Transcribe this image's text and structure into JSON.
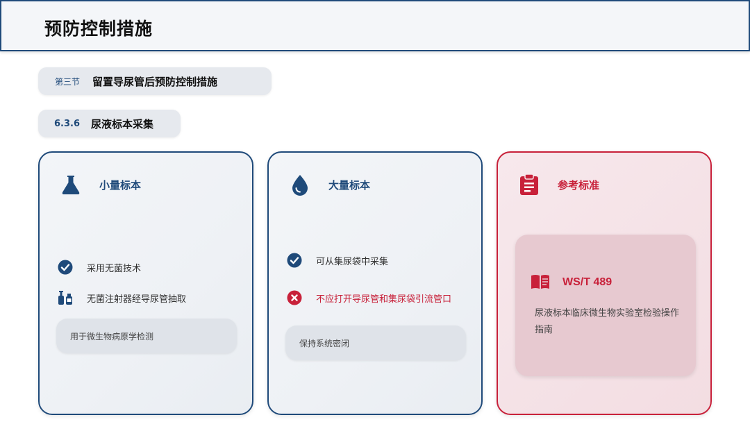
{
  "header": {
    "title": "预防控制措施"
  },
  "section": {
    "tag": "第三节",
    "title": "留置导尿管后预防控制措施"
  },
  "subsection": {
    "tag": "6.3.6",
    "title": "尿液标本采集"
  },
  "cards": [
    {
      "title": "小量标本",
      "icon": "flask-icon",
      "items": [
        {
          "icon": "check-circle-icon",
          "text": "采用无菌技术"
        },
        {
          "icon": "syringe-icon",
          "text": "无菌注射器经导尿管抽取"
        }
      ],
      "note": "用于微生物病原学检测"
    },
    {
      "title": "大量标本",
      "icon": "droplet-icon",
      "items": [
        {
          "icon": "check-circle-icon",
          "text": "可从集尿袋中采集"
        },
        {
          "icon": "x-circle-icon",
          "text": "不应打开导尿管和集尿袋引流管口"
        }
      ],
      "note": "保持系统密闭"
    },
    {
      "title": "参考标准",
      "icon": "clipboard-icon",
      "reference": {
        "icon": "book-icon",
        "code": "WS/T 489",
        "description": "尿液标本临床微生物实验室检验操作指南"
      }
    }
  ],
  "colors": {
    "navy": "#1f4a7a",
    "red": "#c8213a"
  }
}
